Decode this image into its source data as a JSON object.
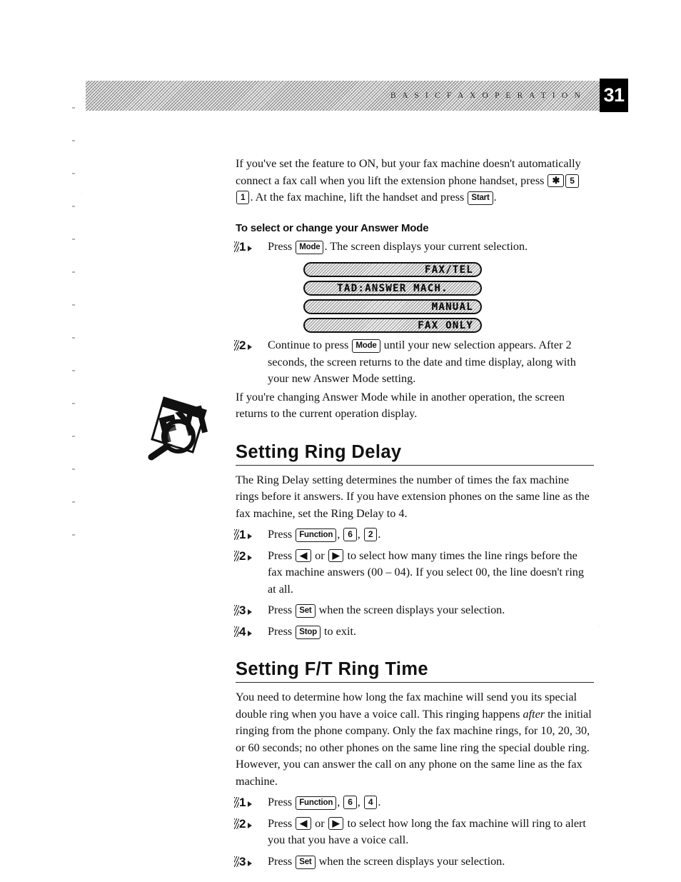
{
  "header": {
    "running_title": "B A S I C   F A X   O P E R A T I O N",
    "page_number": "31"
  },
  "intro": {
    "paragraph_part1": "If you've set the feature to ON, but your fax machine doesn't automatically connect a fax call when you lift the extension phone handset, press ",
    "key_star": "✱",
    "key_5": "5",
    "key_1": "1",
    "paragraph_part2": ". At the fax machine, lift the handset and press ",
    "key_start": "Start",
    "paragraph_part3": "."
  },
  "answer_mode": {
    "subheading": "To select or change your Answer Mode",
    "step1": {
      "number": "1",
      "text_before": "Press ",
      "key_mode": "Mode",
      "text_after": ". The screen displays your current selection."
    },
    "lcd_displays": [
      {
        "text": "FAX/TEL",
        "align": "right"
      },
      {
        "text": "TAD:ANSWER MACH.",
        "align": "center"
      },
      {
        "text": "MANUAL",
        "align": "right"
      },
      {
        "text": "FAX ONLY",
        "align": "right"
      }
    ],
    "step2": {
      "number": "2",
      "text_before": "Continue to press ",
      "key_mode": "Mode",
      "text_after": " until your new selection appears. After 2 seconds, the screen returns to the date and time display, along with your new Answer Mode setting."
    },
    "closing_paragraph": "If you're changing Answer Mode while in another operation, the screen returns to the current operation display."
  },
  "fyi": {
    "icon_label": "FYI"
  },
  "ring_delay": {
    "heading": "Setting Ring Delay",
    "intro": "The Ring Delay setting determines the number of times the fax machine rings before it answers. If you have extension phones on the same line as the fax machine, set the Ring Delay to 4.",
    "steps": [
      {
        "number": "1",
        "text_before": "Press ",
        "key_function": "Function",
        "sep1": ", ",
        "key_a": "6",
        "sep2": ", ",
        "key_b": "2",
        "text_after": "."
      },
      {
        "number": "2",
        "text_before": "Press ",
        "key_left": "◀",
        "text_mid": " or ",
        "key_right": "▶",
        "text_after": " to select how many times the line rings before the fax machine answers (00 – 04). If you select 00, the line doesn't ring at all."
      },
      {
        "number": "3",
        "text_before": "Press ",
        "key_set": "Set",
        "text_after": " when the screen displays your selection."
      },
      {
        "number": "4",
        "text_before": "Press ",
        "key_stop": "Stop",
        "text_after": " to exit."
      }
    ]
  },
  "ft_ring_time": {
    "heading": "Setting F/T Ring Time",
    "intro_part1": "You need to determine how long the fax machine will send you its special double ring when you have a voice call. This ringing happens ",
    "intro_italic": "after",
    "intro_part2": " the initial ringing from the phone company. Only the fax machine rings, for 10, 20, 30, or 60 seconds; no other phones on the same line ring the special double ring. However, you can answer the call on any phone on the same line as the fax machine.",
    "steps": [
      {
        "number": "1",
        "text_before": "Press ",
        "key_function": "Function",
        "sep1": ", ",
        "key_a": "6",
        "sep2": ", ",
        "key_b": "4",
        "text_after": "."
      },
      {
        "number": "2",
        "text_before": "Press ",
        "key_left": "◀",
        "text_mid": " or ",
        "key_right": "▶",
        "text_after": " to select how long the fax machine will ring to alert you that you have a voice call."
      },
      {
        "number": "3",
        "text_before": "Press ",
        "key_set": "Set",
        "text_after": " when the screen displays your selection."
      }
    ]
  },
  "colors": {
    "ink": "#111111",
    "page_number_bg": "#000000",
    "page_number_fg": "#ffffff",
    "header_band": "#bdbdbd",
    "lcd_bg": "#d6d6d6"
  }
}
